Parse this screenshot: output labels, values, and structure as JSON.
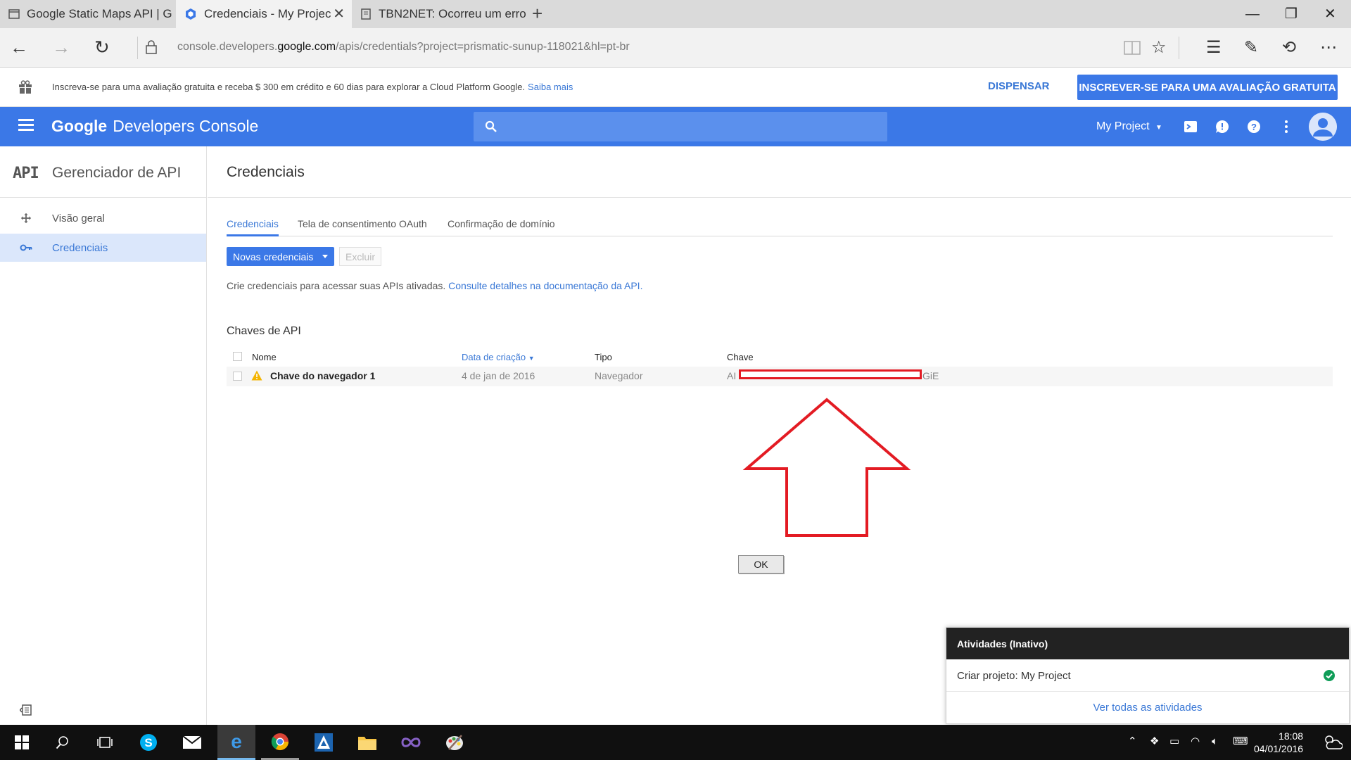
{
  "browser": {
    "tabs": [
      {
        "title": "Google Static Maps API | G",
        "active": false
      },
      {
        "title": "Credenciais - My Projec",
        "active": true
      },
      {
        "title": "TBN2NET: Ocorreu um erro",
        "active": false
      }
    ],
    "url_prefix": "console.developers.",
    "url_domain": "google.com",
    "url_path": "/apis/credentials?project=prismatic-sunup-118021&hl=pt-br"
  },
  "trial": {
    "text": "Inscreva-se para uma avaliação gratuita e receba $ 300 em crédito e 60 dias para explorar a Cloud Platform Google.",
    "link": "Saiba mais",
    "dismiss": "DISPENSAR",
    "signup": "INSCREVER-SE PARA UMA AVALIAÇÃO GRATUITA"
  },
  "header": {
    "brand_google": "Google",
    "brand_product": "Developers Console",
    "project": "My Project",
    "accent": "#3b78e7"
  },
  "sidebar": {
    "logo": "API",
    "title": "Gerenciador de API",
    "items": [
      {
        "label": "Visão geral",
        "icon": "move-icon",
        "active": false
      },
      {
        "label": "Credenciais",
        "icon": "key-icon",
        "active": true
      }
    ]
  },
  "main": {
    "title": "Credenciais",
    "tabs": [
      {
        "label": "Credenciais",
        "active": true
      },
      {
        "label": "Tela de consentimento OAuth",
        "active": false
      },
      {
        "label": "Confirmação de domínio",
        "active": false
      }
    ],
    "new_credentials": "Novas credenciais",
    "delete": "Excluir",
    "help_text": "Crie credenciais para acessar suas APIs ativadas.",
    "help_link": "Consulte detalhes na documentação da API.",
    "section_title": "Chaves de API",
    "table": {
      "columns": [
        "Nome",
        "Data de criação",
        "Tipo",
        "Chave"
      ],
      "sorted_column": "Data de criação",
      "rows": [
        {
          "name": "Chave do navegador 1",
          "date": "4 de jan de 2016",
          "type": "Navegador",
          "key_start": "AI",
          "key_end": "GiE",
          "warning": true
        }
      ]
    },
    "ok": "OK",
    "annotation_color": "#e31b23"
  },
  "activities": {
    "title": "Atividades (Inativo)",
    "item": "Criar projeto: My Project",
    "link": "Ver todas as atividades",
    "status_color": "#0f9d58"
  },
  "taskbar": {
    "time": "18:08",
    "date": "04/01/2016"
  }
}
